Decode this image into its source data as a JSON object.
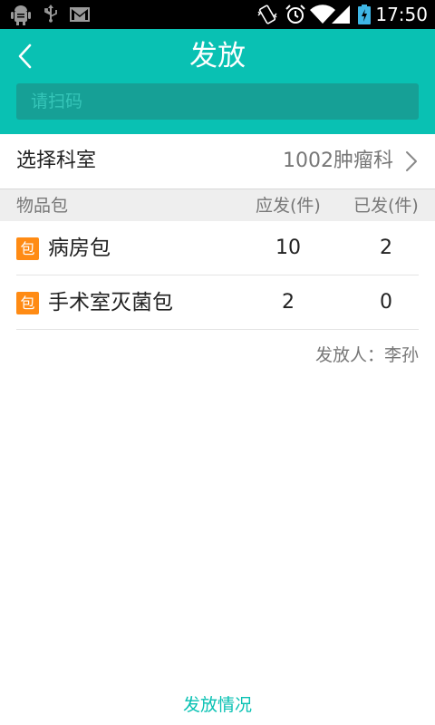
{
  "status_bar": {
    "time": "17:50",
    "icons": [
      "android-debug-icon",
      "usb-icon",
      "gmail-icon",
      "vibrate-icon",
      "alarm-icon",
      "wifi-icon",
      "signal-icon",
      "battery-charging-icon"
    ]
  },
  "header": {
    "title": "发放",
    "scan_placeholder": "请扫码",
    "background_color": "#09c1b3"
  },
  "department": {
    "label": "选择科室",
    "value": "1002肿瘤科"
  },
  "table": {
    "headers": {
      "name": "物品包",
      "due": "应发(件)",
      "issued": "已发(件)"
    },
    "rows": [
      {
        "badge": "包",
        "name": "病房包",
        "due": "10",
        "issued": "2"
      },
      {
        "badge": "包",
        "name": "手术室灭菌包",
        "due": "2",
        "issued": "0"
      }
    ],
    "badge_color": "#ff8b14"
  },
  "issuer": "发放人：李孙",
  "footer": {
    "link_label": "发放情况"
  }
}
